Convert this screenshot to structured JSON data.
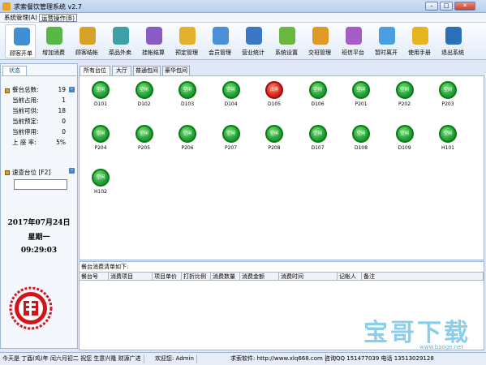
{
  "window": {
    "title": "求索餐饮管理系统 v2.7",
    "btn_min": "–",
    "btn_max": "□",
    "btn_close": "✕"
  },
  "menu": {
    "items": [
      "系统管理(A)",
      "运营操作(B)"
    ]
  },
  "toolbar": {
    "items": [
      {
        "label": "顾客开单",
        "icon": "order-pencil-icon",
        "color": "#3f8fd2"
      },
      {
        "label": "增加消费",
        "icon": "add-consume-icon",
        "color": "#57b846"
      },
      {
        "label": "顾客结帐",
        "icon": "coins-checkout-icon",
        "color": "#d8a22a"
      },
      {
        "label": "菜品外卖",
        "icon": "takeaway-globe-icon",
        "color": "#3ba0a8"
      },
      {
        "label": "挂帐结算",
        "icon": "credit-settle-icon",
        "color": "#8a5bc4"
      },
      {
        "label": "预定管理",
        "icon": "reservation-icon",
        "color": "#e3b12c"
      },
      {
        "label": "会员管理",
        "icon": "members-icon",
        "color": "#4b8fd8"
      },
      {
        "label": "营业统计",
        "icon": "statistics-chart-icon",
        "color": "#3a78c5"
      },
      {
        "label": "系统设置",
        "icon": "settings-cubes-icon",
        "color": "#6bb63d"
      },
      {
        "label": "交班管理",
        "icon": "shift-handover-icon",
        "color": "#e09826"
      },
      {
        "label": "班信平台",
        "icon": "message-platform-icon",
        "color": "#a65cc6"
      },
      {
        "label": "暂时离开",
        "icon": "away-person-icon",
        "color": "#4a9fe0"
      },
      {
        "label": "使用手册",
        "icon": "help-manual-icon",
        "color": "#e7b320"
      },
      {
        "label": "退出系统",
        "icon": "power-exit-icon",
        "color": "#2b6fb8"
      }
    ]
  },
  "left": {
    "tab": "状态",
    "stats": [
      {
        "label": "餐台总数:",
        "value": "19"
      },
      {
        "label": "当前占用:",
        "value": "1"
      },
      {
        "label": "当前可供:",
        "value": "18"
      },
      {
        "label": "当前预定:",
        "value": "0"
      },
      {
        "label": "当前停用:",
        "value": "0"
      },
      {
        "label": "上 座 率:",
        "value": "5%"
      }
    ],
    "quick_search_label": "速查台位 [F2]",
    "date": "2017年07月24日",
    "weekday": "星期一",
    "time": "09:29:03"
  },
  "tabs": [
    "所有台位",
    "大厅",
    "普通包间",
    "豪华包间"
  ],
  "tables": [
    {
      "name": "D101",
      "status": "空闲"
    },
    {
      "name": "D102",
      "status": "空闲"
    },
    {
      "name": "D103",
      "status": "空闲"
    },
    {
      "name": "D104",
      "status": "空闲"
    },
    {
      "name": "D105",
      "status": "占用"
    },
    {
      "name": "D106",
      "status": "空闲"
    },
    {
      "name": "P201",
      "status": "空闲"
    },
    {
      "name": "P202",
      "status": "空闲"
    },
    {
      "name": "P203",
      "status": "空闲"
    },
    {
      "name": "P204",
      "status": "空闲"
    },
    {
      "name": "P205",
      "status": "空闲"
    },
    {
      "name": "P206",
      "status": "空闲"
    },
    {
      "name": "P207",
      "status": "空闲"
    },
    {
      "name": "P208",
      "status": "空闲"
    },
    {
      "name": "D107",
      "status": "空闲"
    },
    {
      "name": "D108",
      "status": "空闲"
    },
    {
      "name": "D109",
      "status": "空闲"
    },
    {
      "name": "H101",
      "status": "空闲"
    },
    {
      "name": "H102",
      "status": "空闲"
    }
  ],
  "detail": {
    "title": "餐台消费清单如下:",
    "columns": [
      "餐台号",
      "消费项目",
      "项目单价",
      "打折比例",
      "消费数量",
      "消费金额",
      "消费时间",
      "记帐人",
      "备注"
    ]
  },
  "watermark": {
    "text": "宝哥下载",
    "url": "www.baoge.net"
  },
  "statusbar": {
    "items": [
      "今天是 丁酉(鸡)年 闰六月初二 祝您 生意兴隆 财源广进",
      "欢迎您: Admin",
      "求索软件: http://www.xlq668.com",
      "咨询QQ 151477039 电话 13513029128"
    ]
  }
}
